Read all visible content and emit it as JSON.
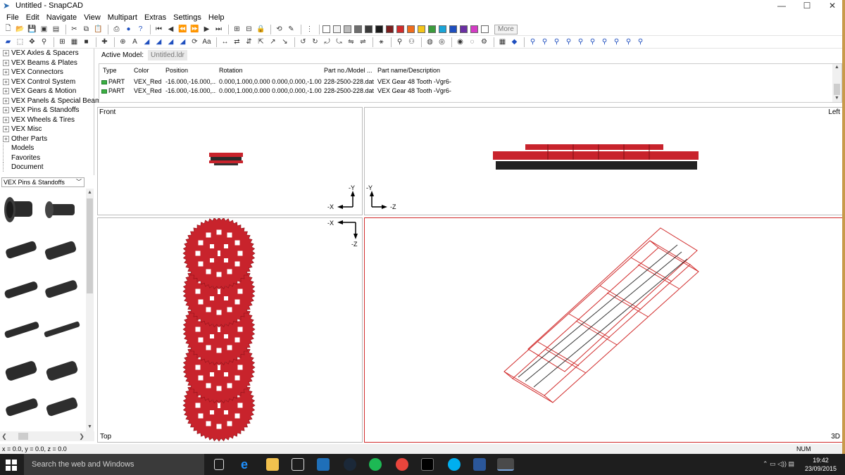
{
  "window": {
    "title": "Untitled - SnapCAD",
    "min": "—",
    "max": "☐",
    "close": "✕"
  },
  "menu": [
    "File",
    "Edit",
    "Navigate",
    "View",
    "Multipart",
    "Extras",
    "Settings",
    "Help"
  ],
  "toolbar": {
    "more_label": "More"
  },
  "colors": {
    "swatches": [
      "#ffffff",
      "#f2f2f2",
      "#bcbcbc",
      "#6e6e6e",
      "#3a3a3a",
      "#1a1a1a",
      "#7a1f1f",
      "#d12b2b",
      "#f06c1c",
      "#f5c518",
      "#3c9c3c",
      "#1aa5d8",
      "#1f4fbf",
      "#6b2fa3",
      "#d43cc5",
      "#ffffff"
    ],
    "gear_red": "#c8232c"
  },
  "tree": {
    "items": [
      {
        "label": "VEX Axles & Spacers",
        "expandable": true
      },
      {
        "label": "VEX Beams & Plates",
        "expandable": true
      },
      {
        "label": "VEX Connectors",
        "expandable": true
      },
      {
        "label": "VEX Control System",
        "expandable": true
      },
      {
        "label": "VEX Gears & Motion",
        "expandable": true
      },
      {
        "label": "VEX Panels & Special Beams",
        "expandable": true
      },
      {
        "label": "VEX Pins & Standoffs",
        "expandable": true
      },
      {
        "label": "VEX Wheels & Tires",
        "expandable": true
      },
      {
        "label": "VEX Misc",
        "expandable": true
      },
      {
        "label": "Other Parts",
        "expandable": true
      },
      {
        "label": "Models",
        "expandable": false
      },
      {
        "label": "Favorites",
        "expandable": false
      },
      {
        "label": "Document",
        "expandable": false
      }
    ]
  },
  "category_select": {
    "value": "VEX Pins & Standoffs"
  },
  "model": {
    "label": "Active Model:",
    "tab": "Untitled.ldr"
  },
  "table": {
    "headers": [
      "Type",
      "Color",
      "Position",
      "Rotation",
      "Part no./Model ...",
      "Part name/Description"
    ],
    "rows": [
      [
        "PART",
        "VEX_Red",
        "-16.000,-16.000,...",
        "0.000,1.000,0.000 0.000,0.000,-1.00...",
        "228-2500-228.dat",
        "VEX Gear 48 Tooth -Vgr6-"
      ],
      [
        "PART",
        "VEX_Red",
        "-16.000,-16.000,...",
        "0.000,1.000,0.000 0.000,0.000,-1.00...",
        "228-2500-228.dat",
        "VEX Gear 48 Tooth -Vgr6-"
      ]
    ]
  },
  "viewports": {
    "front": "Front",
    "left": "Left",
    "top": "Top",
    "three_d": "3D",
    "axes": {
      "neg_y": "-Y",
      "neg_x": "-X",
      "neg_z": "-Z"
    }
  },
  "status": {
    "coords": "x = 0.0, y = 0.0, z = 0.0",
    "num": "NUM"
  },
  "taskbar": {
    "search": "Search the web and Windows",
    "time": "19:42",
    "date": "23/09/2015"
  }
}
